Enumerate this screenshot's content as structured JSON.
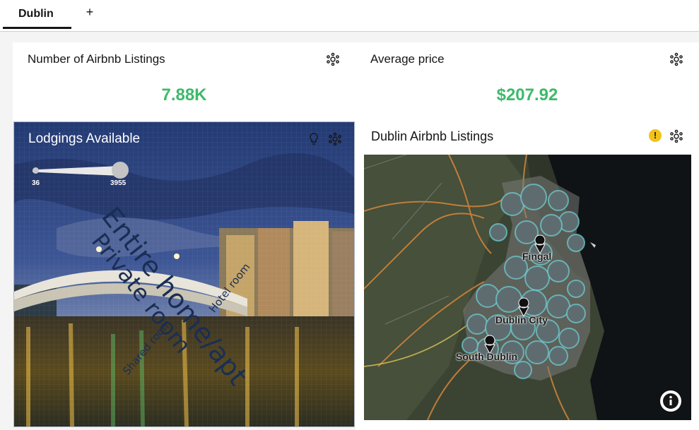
{
  "tabs": [
    {
      "label": "Dublin",
      "active": true
    }
  ],
  "add_tab_label": "+",
  "kpi_listings": {
    "title": "Number of Airbnb Listings",
    "value": "7.88K",
    "value_color": "#3dba6a"
  },
  "kpi_price": {
    "title": "Average price",
    "value": "$207.92",
    "value_color": "#3dba6a"
  },
  "lodgings": {
    "title": "Lodgings Available",
    "slider": {
      "min": "36",
      "max": "3955"
    },
    "word_cloud": [
      "Entire home/apt",
      "Private room",
      "Hotel room",
      "Shared room"
    ]
  },
  "map_card": {
    "title": "Dublin Airbnb Listings",
    "labels": [
      "Fingal",
      "Dublin City",
      "South Dublin"
    ],
    "status_icon": "warning-icon",
    "status_color": "#f1c21b"
  },
  "icons": {
    "card_menu": "settings-icon",
    "insight": "lightbulb-icon",
    "info": "info-icon"
  }
}
